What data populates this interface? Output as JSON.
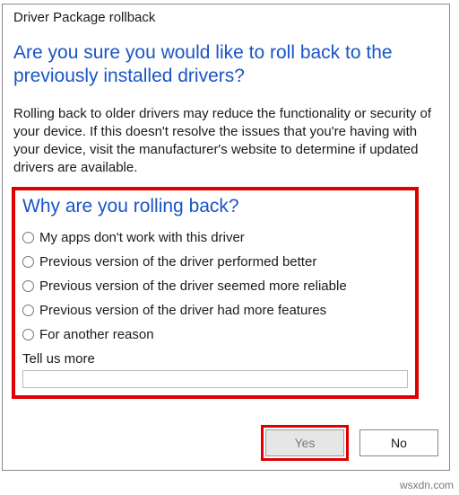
{
  "dialog": {
    "title": "Driver Package rollback",
    "question": "Are you sure you would like to roll back to the previously installed drivers?",
    "warning": "Rolling back to older drivers may reduce the functionality or security of your device. If this doesn't resolve the issues that you're having with your device, visit the manufacturer's website to determine if updated drivers are available."
  },
  "reason": {
    "title": "Why are you rolling back?",
    "options": [
      "My apps don't work with this driver",
      "Previous version of the driver performed better",
      "Previous version of the driver seemed more reliable",
      "Previous version of the driver had more features",
      "For another reason"
    ],
    "tell_us_label": "Tell us more",
    "tell_us_value": ""
  },
  "buttons": {
    "yes": "Yes",
    "no": "No"
  },
  "watermark": "wsxdn.com"
}
